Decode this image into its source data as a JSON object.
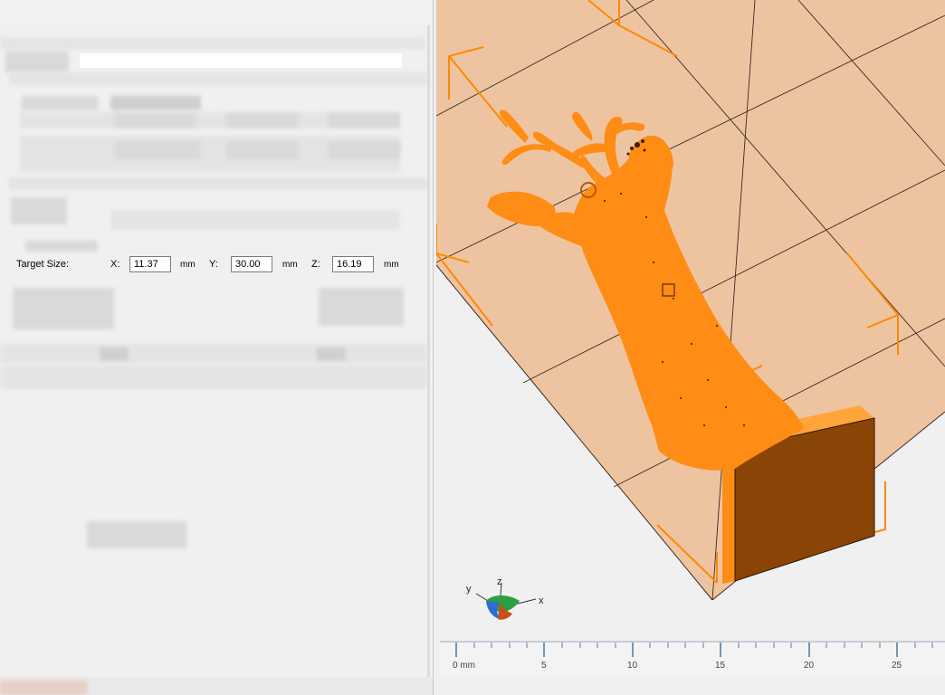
{
  "target_size": {
    "label": "Target Size:",
    "x_label": "X:",
    "x_value": "11.37",
    "y_label": "Y:",
    "y_value": "30.00",
    "z_label": "Z:",
    "z_value": "16.19",
    "unit": "mm"
  },
  "axis_gizmo": {
    "x": "x",
    "y": "y",
    "z": "z"
  },
  "ruler": {
    "labels": [
      "0 mm",
      "5",
      "10",
      "15",
      "20",
      "25"
    ]
  },
  "colors": {
    "model": "#ff8c14",
    "model_face": "#8a4506",
    "build_plate": "#eec4a0",
    "selection_box": "#ff8800"
  }
}
